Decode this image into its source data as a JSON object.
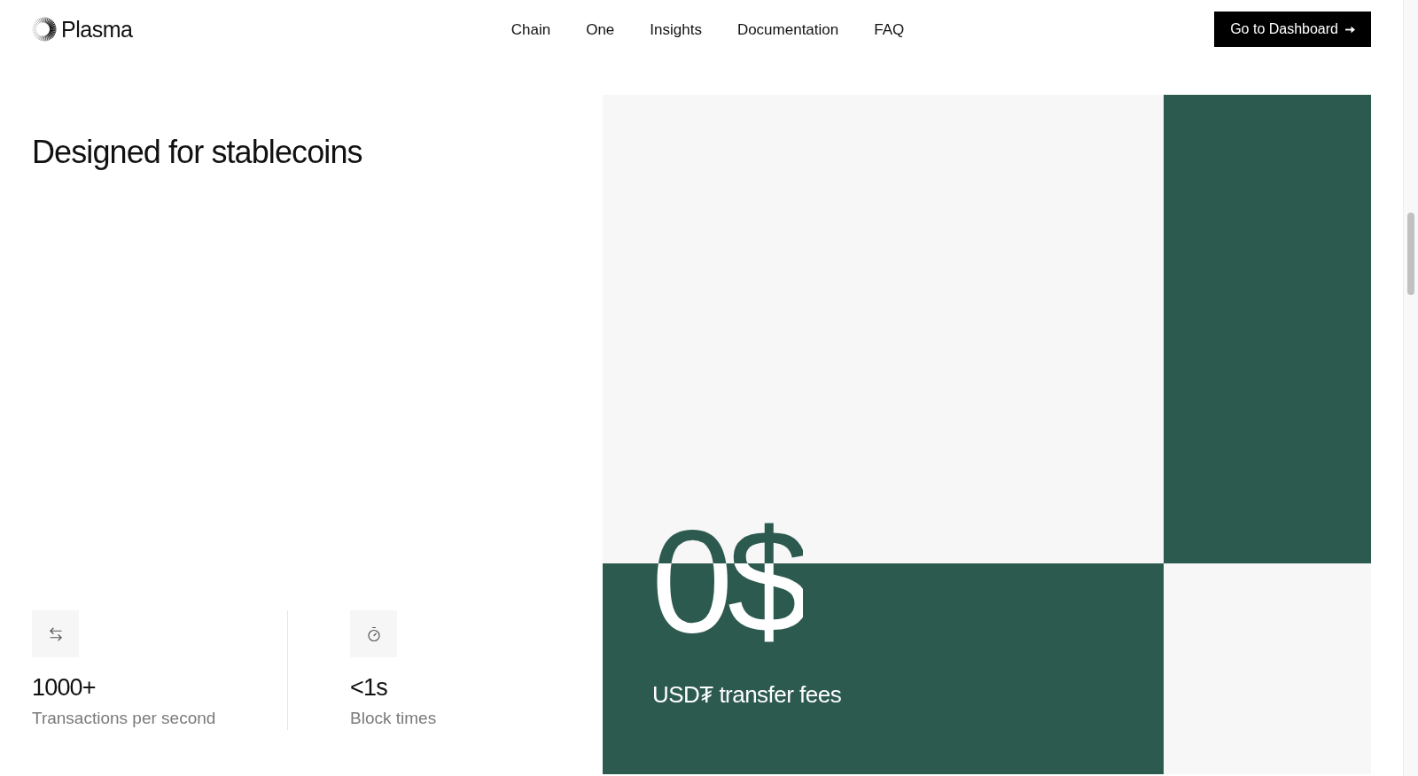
{
  "header": {
    "logo": {
      "text": "Plasma"
    },
    "nav": [
      {
        "label": "Chain"
      },
      {
        "label": "One"
      },
      {
        "label": "Insights"
      },
      {
        "label": "Documentation"
      },
      {
        "label": "FAQ"
      }
    ],
    "cta": {
      "label": "Go to Dashboard"
    }
  },
  "hero": {
    "title": "Designed for stablecoins"
  },
  "stats": [
    {
      "kind": "transfers",
      "value": "1000+",
      "label": "Transactions per second"
    },
    {
      "kind": "timer",
      "value": "<1s",
      "label": "Block times"
    }
  ],
  "feature_panel": {
    "value": "0$",
    "caption": "USD₮ transfer fees"
  }
}
